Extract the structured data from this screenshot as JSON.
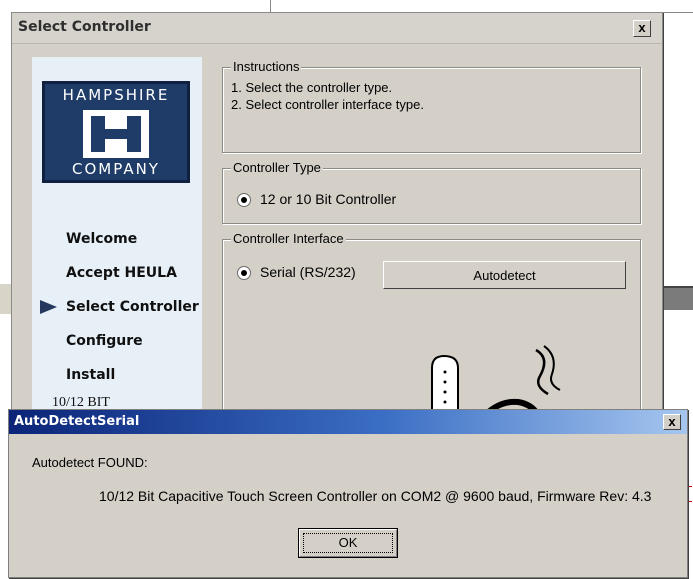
{
  "main_window": {
    "title": "Select Controller",
    "close_label": "x",
    "logo": {
      "line1": "HAMPSHIRE",
      "line2": "COMPANY"
    },
    "nav": [
      "Welcome",
      "Accept HEULA",
      "Select Controller",
      "Configure",
      "Install"
    ],
    "version": "10/12 BIT",
    "instructions": {
      "legend": "Instructions",
      "lines": [
        "1. Select the controller type.",
        "2. Select controller interface type."
      ]
    },
    "controller_type": {
      "legend": "Controller Type",
      "option": "12 or 10 Bit Controller"
    },
    "controller_interface": {
      "legend": "Controller Interface",
      "option": "Serial (RS/232)",
      "autodetect_button": "Autodetect"
    }
  },
  "dialog": {
    "title": "AutoDetectSerial",
    "close_label": "x",
    "found_label": "Autodetect FOUND:",
    "message": "10/12 Bit Capacitive Touch Screen Controller on COM2 @ 9600 baud, Firmware Rev: 4.3",
    "ok_label": "OK"
  }
}
